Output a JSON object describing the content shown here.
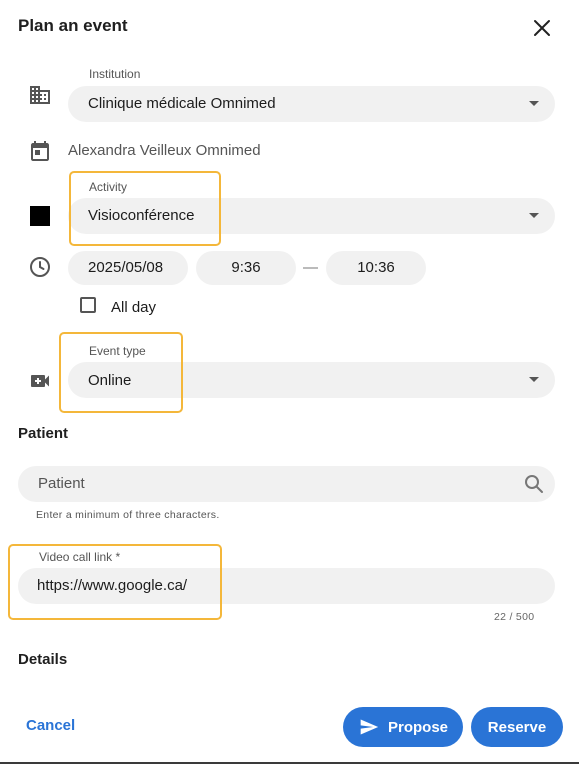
{
  "dialog": {
    "title": "Plan an event"
  },
  "institution": {
    "label": "Institution",
    "value": "Clinique médicale Omnimed"
  },
  "practitioner": {
    "value": "Alexandra Veilleux Omnimed"
  },
  "activity": {
    "label": "Activity",
    "value": "Visioconférence",
    "color": "#000000"
  },
  "schedule": {
    "date": "2025/05/08",
    "start": "9:36",
    "separator": "—",
    "end": "10:36"
  },
  "all_day": {
    "label": "All day",
    "checked": false
  },
  "event_type": {
    "label": "Event type",
    "value": "Online"
  },
  "patient": {
    "section_title": "Patient",
    "placeholder": "Patient",
    "hint": "Enter a minimum of three characters."
  },
  "video_link": {
    "label": "Video call link *",
    "value": "https://www.google.ca/",
    "counter": "22 / 500"
  },
  "details": {
    "section_title": "Details"
  },
  "actions": {
    "cancel": "Cancel",
    "propose": "Propose",
    "reserve": "Reserve"
  },
  "colors": {
    "accent": "#2a74d6",
    "highlight": "#f4b73a",
    "field_bg": "#f1f1f1"
  },
  "icons": [
    "close-icon",
    "building-icon",
    "calendar-icon",
    "clock-icon",
    "video-add-icon",
    "search-icon",
    "send-icon"
  ]
}
